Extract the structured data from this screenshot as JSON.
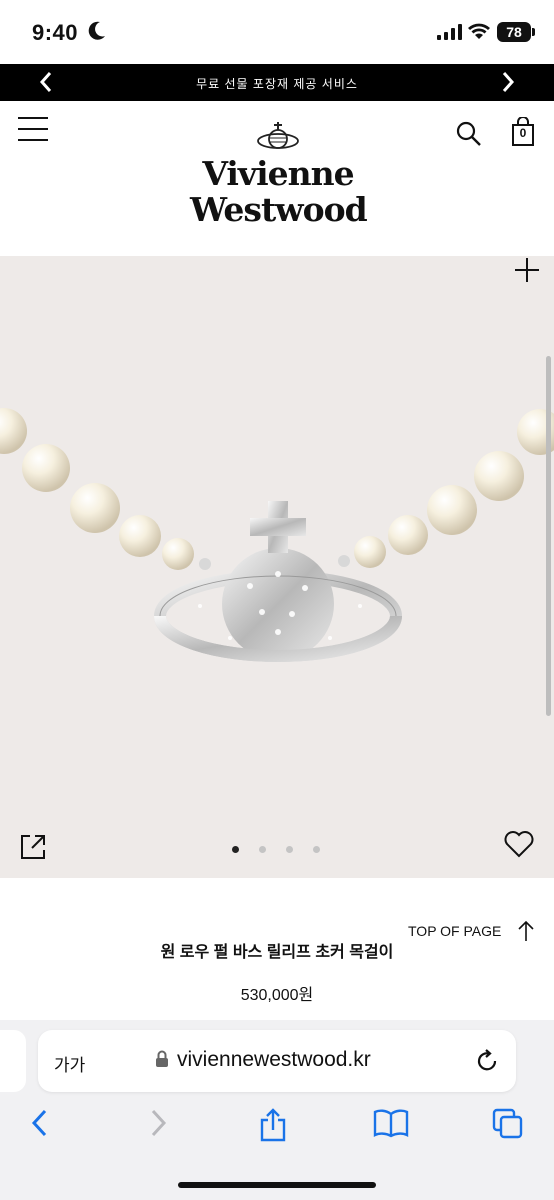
{
  "status_bar": {
    "time": "9:40",
    "battery": "78"
  },
  "promo": {
    "text": "무료 선물 포장재 제공 서비스"
  },
  "brand": {
    "line1": "Vivienne",
    "line2": "Westwood"
  },
  "bag": {
    "count": "0"
  },
  "gallery": {
    "slide_count": 4,
    "active_slide": 1
  },
  "product": {
    "name": "원 로우 펄 바스 릴리프 초커 목걸이",
    "price": "530,000원"
  },
  "back_to_top": {
    "label": "TOP OF PAGE"
  },
  "browser": {
    "text_size_label": "가가",
    "url": "viviennewestwood.kr"
  },
  "icons": [
    "moon-icon",
    "signal-icon",
    "wifi-icon",
    "chevron-left-icon",
    "chevron-right-icon",
    "menu-icon",
    "orb-logo-icon",
    "search-icon",
    "bag-icon",
    "plus-icon",
    "share-icon",
    "heart-icon",
    "arrow-up-icon",
    "lock-icon",
    "reload-icon",
    "back-icon",
    "forward-icon",
    "share-sheet-icon",
    "bookmarks-icon",
    "tabs-icon"
  ],
  "colors": {
    "promo_bg": "#000000",
    "hero_bg": "#eeeae8",
    "browser_accent": "#1a73e8"
  }
}
